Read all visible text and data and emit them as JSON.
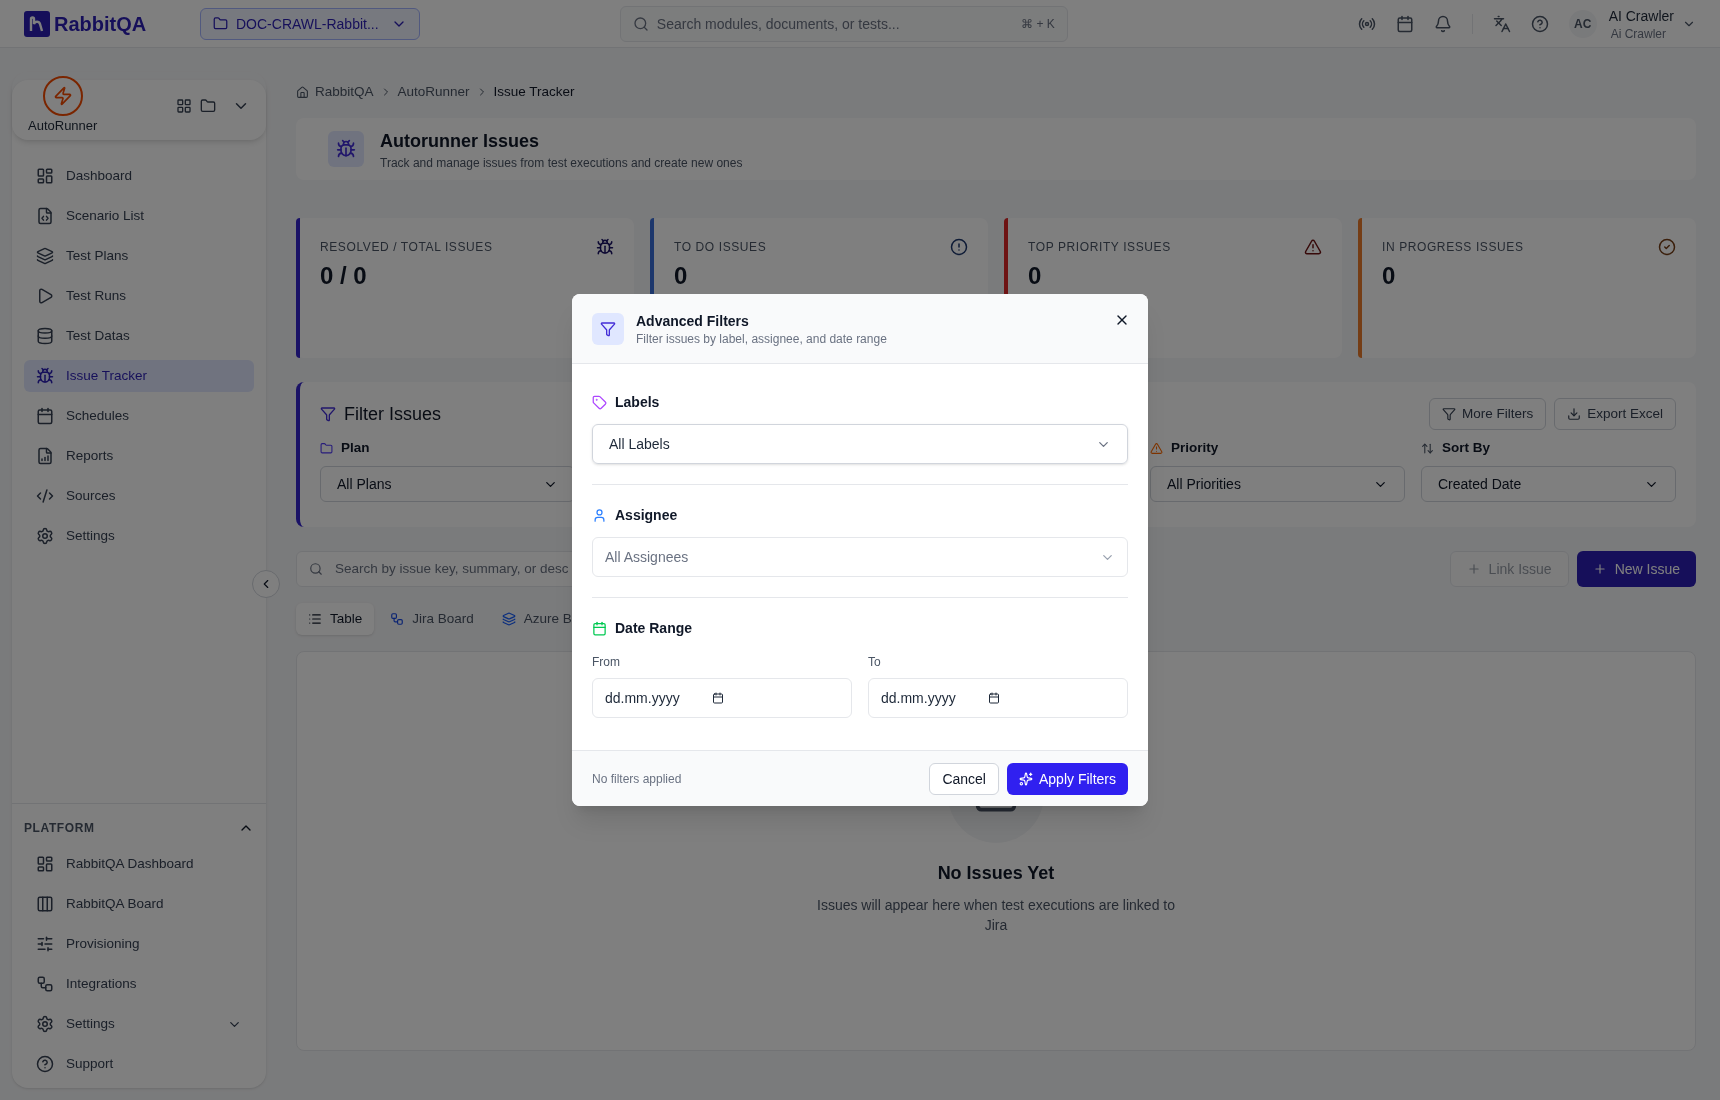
{
  "topbar": {
    "logo": "RabbitQA",
    "project": "DOC-CRAWL-Rabbit...",
    "search_placeholder": "Search modules, documents, or tests...",
    "shortcut": "⌘ + K",
    "user": {
      "initials": "AC",
      "name": "AI Crawler",
      "subtitle": "Ai Crawler"
    }
  },
  "sidebar": {
    "module": "AutoRunner",
    "items": [
      {
        "label": "Dashboard",
        "kind": "dashboard",
        "selected": false
      },
      {
        "label": "Scenario List",
        "kind": "scenario",
        "selected": false
      },
      {
        "label": "Test Plans",
        "kind": "plans",
        "selected": false
      },
      {
        "label": "Test Runs",
        "kind": "runs",
        "selected": false
      },
      {
        "label": "Test Datas",
        "kind": "data",
        "selected": false
      },
      {
        "label": "Issue Tracker",
        "kind": "issues",
        "selected": true
      },
      {
        "label": "Schedules",
        "kind": "schedules",
        "selected": false
      },
      {
        "label": "Reports",
        "kind": "reports",
        "selected": false
      },
      {
        "label": "Sources",
        "kind": "sources",
        "selected": false
      },
      {
        "label": "Settings",
        "kind": "settings",
        "selected": false
      }
    ],
    "platform": {
      "title": "PLATFORM",
      "expanded": true,
      "items": [
        {
          "label": "RabbitQA Dashboard",
          "kind": "dashboard"
        },
        {
          "label": "RabbitQA Board",
          "kind": "board"
        },
        {
          "label": "Provisioning",
          "kind": "provisioning"
        },
        {
          "label": "Integrations",
          "kind": "integrations"
        },
        {
          "label": "Settings",
          "kind": "settings",
          "expanded": false
        },
        {
          "label": "Support",
          "kind": "support"
        }
      ]
    }
  },
  "breadcrumb": [
    "RabbitQA",
    "AutoRunner",
    "Issue Tracker"
  ],
  "header": {
    "title": "Autorunner Issues",
    "subtitle": "Track and manage issues from test executions and create new ones"
  },
  "stats": [
    {
      "label": "RESOLVED / TOTAL ISSUES",
      "value": "0 / 0",
      "kind": "resolved",
      "color": "#1a1266"
    },
    {
      "label": "TO DO ISSUES",
      "value": "0",
      "kind": "todo",
      "color": "#1d376c"
    },
    {
      "label": "TOP PRIORITY ISSUES",
      "value": "0",
      "kind": "priority",
      "color": "#6e1313"
    },
    {
      "label": "IN PROGRESS ISSUES",
      "value": "0",
      "kind": "progress",
      "color": "#753d15"
    }
  ],
  "filters": {
    "title": "Filter Issues",
    "buttons": [
      {
        "label": "More Filters",
        "kind": "filter"
      },
      {
        "label": "Export Excel",
        "kind": "export"
      }
    ],
    "fields": [
      {
        "label": "Plan",
        "value": "All Plans",
        "kind": "plan"
      },
      {
        "label": "Priority",
        "value": "All Priorities",
        "kind": "priority"
      },
      {
        "label": "Sort By",
        "value": "Created Date",
        "kind": "sort"
      }
    ]
  },
  "search_placeholder": "Search by issue key, summary, or desc",
  "actions": [
    {
      "label": "Link Issue",
      "kind": "secondary",
      "disabled": true
    },
    {
      "label": "New Issue",
      "kind": "primary",
      "disabled": false
    }
  ],
  "views": [
    {
      "label": "Table",
      "kind": "table",
      "selected": true
    },
    {
      "label": "Jira Board",
      "kind": "jira",
      "selected": false
    },
    {
      "label": "Azure B",
      "kind": "azure",
      "selected": false
    }
  ],
  "empty": {
    "title": "No Issues Yet",
    "text": "Issues will appear here when test executions are linked to Jira"
  },
  "modal": {
    "title": "Advanced Filters",
    "subtitle": "Filter issues by label, assignee, and date range",
    "labels": {
      "label": "Labels",
      "value": "All Labels"
    },
    "assignee": {
      "label": "Assignee",
      "placeholder": "All Assignees"
    },
    "date_range": {
      "label": "Date Range",
      "from_label": "From",
      "from_placeholder": "dd.mm.yyyy",
      "to_label": "To",
      "to_placeholder": "dd.mm.yyyy"
    },
    "status": "No filters applied",
    "cancel": "Cancel",
    "apply": "Apply Filters"
  }
}
